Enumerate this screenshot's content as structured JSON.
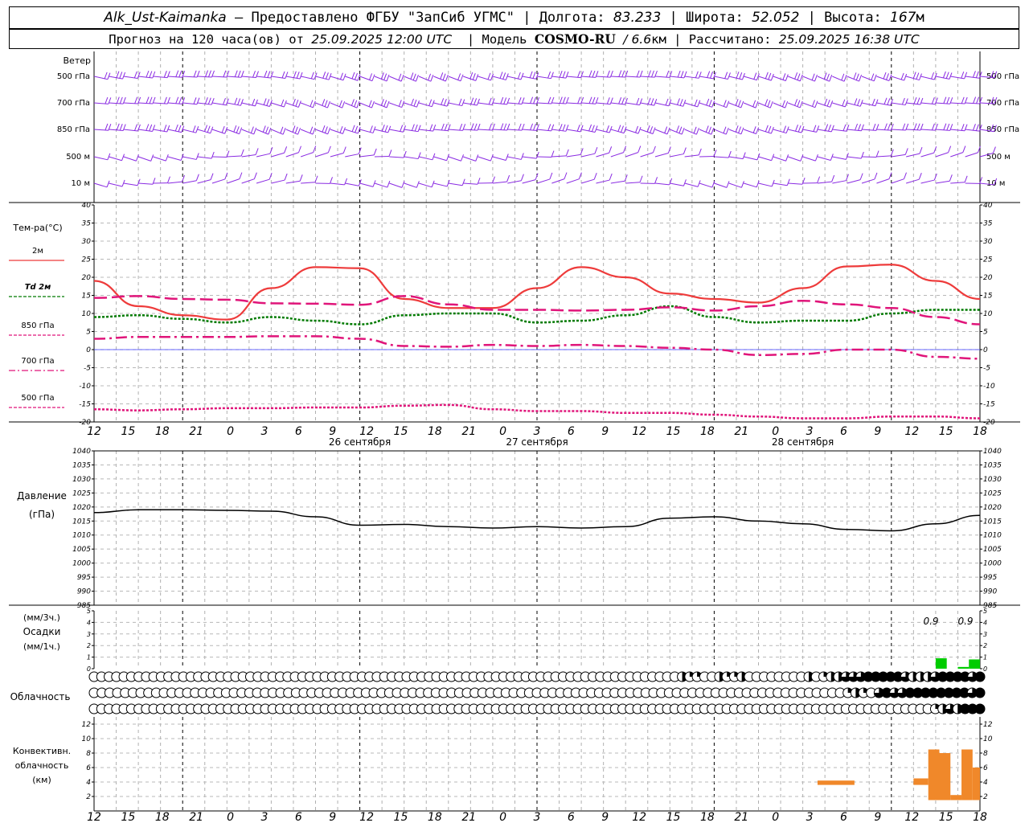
{
  "header": {
    "station": "Alk_Ust-Kaimanka",
    "sep1": " — ",
    "provider": "Предоставлено ФГБУ \"ЗапСиб УГМС\"",
    "lon_label": "Долгота:",
    "lon": "83.233",
    "lat_label": "Широта:",
    "lat": "52.052",
    "alt_label": "Высота:",
    "alt": "167",
    "alt_unit": "м",
    "forecast_label": "Прогноз на 120 часа(ов) от",
    "forecast_time": "25.09.2025 12:00 UTC",
    "model_label": "Модель",
    "model": "COSMO-RU",
    "model_res": "/ 6.6",
    "model_res_unit": "км",
    "calc_label": "Рассчитано:",
    "calc_time": "25.09.2025 16:38 UTC"
  },
  "x_axis": {
    "hour_labels": [
      "12",
      "15",
      "18",
      "21",
      "0",
      "3",
      "6",
      "9",
      "12",
      "15",
      "18",
      "21",
      "0",
      "3",
      "6",
      "9",
      "12",
      "15",
      "18",
      "21",
      "0",
      "3",
      "6",
      "9",
      "12",
      "15",
      "18"
    ],
    "date_labels": [
      "26 сентября",
      "27 сентября",
      "28 сентября"
    ]
  },
  "wind_panel": {
    "title": "Ветер",
    "levels_left": [
      "500 гПа",
      "700 гПа",
      "850 гПа",
      "500 м",
      "10  м"
    ],
    "levels_right": [
      "500 гПа",
      "700 гПа",
      "850 гПа",
      "500 м",
      "10  м"
    ],
    "color": "#8a2be2"
  },
  "chart_data": [
    {
      "type": "line",
      "title": "Тем-ра(°С)",
      "x": [
        0,
        6,
        12,
        18,
        24,
        30,
        36,
        42,
        48,
        54,
        60,
        66,
        72,
        78,
        84,
        90,
        96,
        102,
        108,
        114,
        120
      ],
      "ylim": [
        -20,
        40
      ],
      "yticks": [
        -20,
        -15,
        -10,
        -5,
        0,
        5,
        10,
        15,
        20,
        25,
        30,
        35,
        40
      ],
      "series": [
        {
          "name": "2м",
          "color": "#ee3b3b",
          "values": [
            19,
            12,
            9.5,
            8.3,
            17,
            22.8,
            22.5,
            14,
            11.5,
            11.5,
            17,
            22.8,
            20,
            15.5,
            14,
            13,
            17,
            23,
            23.5,
            19,
            14
          ]
        },
        {
          "name": "Td  2м",
          "color": "#007a00",
          "values": [
            9,
            9.5,
            8.5,
            7.5,
            9,
            8,
            7,
            9.5,
            10,
            10,
            7.5,
            8,
            9.5,
            12,
            9,
            7.5,
            8,
            8,
            10,
            11,
            11
          ]
        },
        {
          "name": "850 гПа",
          "color": "#e0157a",
          "values": [
            14.3,
            14.8,
            14,
            13.8,
            12.8,
            12.7,
            12.4,
            14.8,
            12.5,
            11,
            11,
            10.8,
            11,
            11.7,
            10.8,
            12,
            13.5,
            12.5,
            11.5,
            9,
            7
          ]
        },
        {
          "name": "700 гПа",
          "color": "#e0157a",
          "values": [
            3,
            3.5,
            3.5,
            3.5,
            3.7,
            3.7,
            3,
            1,
            0.8,
            1.3,
            1,
            1.3,
            1,
            0.5,
            0,
            -1.5,
            -1.2,
            0,
            0,
            -2,
            -2.5
          ]
        },
        {
          "name": "500 гПа",
          "color": "#e0157a",
          "values": [
            -16.5,
            -16.8,
            -16.5,
            -16.2,
            -16.2,
            -16,
            -16,
            -15.5,
            -15.3,
            -16.5,
            -17,
            -17,
            -17.5,
            -17.5,
            -18,
            -18.5,
            -19,
            -19,
            -18.5,
            -18.5,
            -19
          ]
        }
      ]
    },
    {
      "type": "line",
      "title": "Давление",
      "ylabel": "(гПа)",
      "x": [
        0,
        6,
        12,
        18,
        24,
        30,
        36,
        42,
        48,
        54,
        60,
        66,
        72,
        78,
        84,
        90,
        96,
        102,
        108,
        114,
        120
      ],
      "ylim": [
        985,
        1040
      ],
      "yticks": [
        985,
        990,
        995,
        1000,
        1005,
        1010,
        1015,
        1020,
        1025,
        1030,
        1035,
        1040
      ],
      "series": [
        {
          "name": "",
          "color": "#000000",
          "values": [
            1018,
            1019,
            1019,
            1018.8,
            1018.5,
            1016.5,
            1013.5,
            1013.8,
            1013,
            1012.5,
            1013,
            1012.5,
            1013,
            1016,
            1016.5,
            1015,
            1014,
            1012,
            1011.5,
            1014,
            1017
          ]
        }
      ]
    },
    {
      "type": "bar",
      "title": "Осадки",
      "ylabel_top": "(мм/3ч.)",
      "ylabel_bottom": "(мм/1ч.)",
      "ylim": [
        0,
        5
      ],
      "yticks": [
        0,
        1,
        2,
        3,
        4,
        5
      ],
      "annotations": [
        "0.9",
        "0.9"
      ],
      "bars": [
        {
          "x0": 114,
          "x1": 115.5,
          "value": 0.9
        },
        {
          "x0": 117,
          "x1": 118.5,
          "value": 0.15
        },
        {
          "x0": 118.5,
          "x1": 120,
          "value": 0.8
        }
      ],
      "color": "#00cc00"
    },
    {
      "type": "bar",
      "title": "Облачность",
      "rows": 3,
      "note": "cloud cover symbols per hour, 0-1 fraction"
    },
    {
      "type": "bar",
      "title": "Конвективн. облачность (км)",
      "title_lines": [
        "Конвективн.",
        "облачность",
        "(км)"
      ],
      "ylim": [
        0,
        13
      ],
      "yticks": [
        2,
        4,
        6,
        8,
        10,
        12
      ],
      "color": "#f0882a",
      "bars": [
        {
          "x0": 98,
          "x1": 103,
          "bottom": 3.6,
          "top": 4.2
        },
        {
          "x0": 111,
          "x1": 113,
          "bottom": 3.6,
          "top": 4.5
        },
        {
          "x0": 113,
          "x1": 114.5,
          "bottom": 1.5,
          "top": 8.5
        },
        {
          "x0": 114.5,
          "x1": 116,
          "bottom": 1.5,
          "top": 8
        },
        {
          "x0": 116,
          "x1": 117.5,
          "bottom": 1.5,
          "top": 2.2
        },
        {
          "x0": 117.5,
          "x1": 119,
          "bottom": 1.5,
          "top": 8.5
        },
        {
          "x0": 119,
          "x1": 120,
          "bottom": 1.5,
          "top": 6
        }
      ]
    }
  ],
  "cloud_rows": [
    [
      0,
      0,
      0,
      0,
      0,
      0,
      0,
      0,
      0,
      0,
      0,
      0,
      0,
      0,
      0,
      0,
      0,
      0,
      0,
      0,
      0,
      0,
      0,
      0,
      0,
      0,
      0,
      0,
      0,
      0,
      0,
      0,
      0,
      0,
      0,
      0,
      0,
      0,
      0,
      0,
      0,
      0,
      0,
      0,
      0,
      0,
      0,
      0,
      0,
      0,
      0,
      0,
      0,
      0,
      0,
      0,
      0,
      0,
      0,
      0,
      0,
      0,
      0,
      0,
      0,
      0,
      0,
      0,
      0,
      0,
      0,
      0,
      0,
      0,
      0,
      0,
      0,
      0,
      0,
      0.5,
      0.25,
      0.25,
      0,
      0,
      0.5,
      0.25,
      0.25,
      0.5,
      0,
      0,
      0,
      0,
      0,
      0,
      0,
      0,
      0.5,
      0,
      0.25,
      0.5,
      0.5,
      0.75,
      0.75,
      0.75,
      1,
      1,
      1,
      1,
      1,
      0.75,
      0.5,
      0.5,
      0.5,
      0.75,
      1,
      1,
      1,
      1,
      0.75,
      1
    ],
    [
      0,
      0,
      0,
      0,
      0,
      0,
      0,
      0,
      0,
      0,
      0,
      0,
      0,
      0,
      0,
      0,
      0,
      0,
      0,
      0,
      0,
      0,
      0,
      0,
      0,
      0,
      0,
      0,
      0,
      0,
      0,
      0,
      0,
      0,
      0,
      0,
      0,
      0,
      0,
      0,
      0,
      0,
      0,
      0,
      0,
      0,
      0,
      0,
      0,
      0,
      0,
      0,
      0,
      0,
      0,
      0,
      0,
      0,
      0,
      0,
      0,
      0,
      0,
      0,
      0,
      0,
      0,
      0,
      0,
      0,
      0,
      0,
      0,
      0,
      0,
      0,
      0,
      0,
      0,
      0,
      0,
      0,
      0,
      0,
      0,
      0,
      0,
      0,
      0,
      0,
      0,
      0,
      0,
      0,
      0,
      0,
      0,
      0.25,
      0.5,
      0.25,
      0,
      0.75,
      1,
      0.75,
      0.75,
      1,
      1,
      1,
      1,
      1,
      1,
      1,
      1,
      0.75,
      1
    ],
    [
      0,
      0,
      0,
      0,
      0,
      0,
      0,
      0,
      0,
      0,
      0,
      0,
      0,
      0,
      0,
      0,
      0,
      0,
      0,
      0,
      0,
      0,
      0,
      0,
      0,
      0,
      0,
      0,
      0,
      0,
      0,
      0,
      0,
      0,
      0,
      0,
      0,
      0,
      0,
      0,
      0,
      0,
      0,
      0,
      0,
      0,
      0,
      0,
      0,
      0,
      0,
      0,
      0,
      0,
      0,
      0,
      0,
      0,
      0,
      0,
      0,
      0,
      0,
      0,
      0,
      0,
      0,
      0,
      0,
      0,
      0,
      0,
      0,
      0,
      0,
      0,
      0,
      0,
      0,
      0,
      0,
      0,
      0,
      0,
      0,
      0,
      0,
      0,
      0,
      0,
      0,
      0,
      0,
      0,
      0,
      0,
      0,
      0,
      0,
      0,
      0,
      0,
      0,
      0,
      0,
      0,
      0,
      0,
      0,
      0,
      0,
      0,
      0,
      0.25,
      0.5,
      0.75,
      0.5,
      1,
      1,
      1
    ]
  ]
}
